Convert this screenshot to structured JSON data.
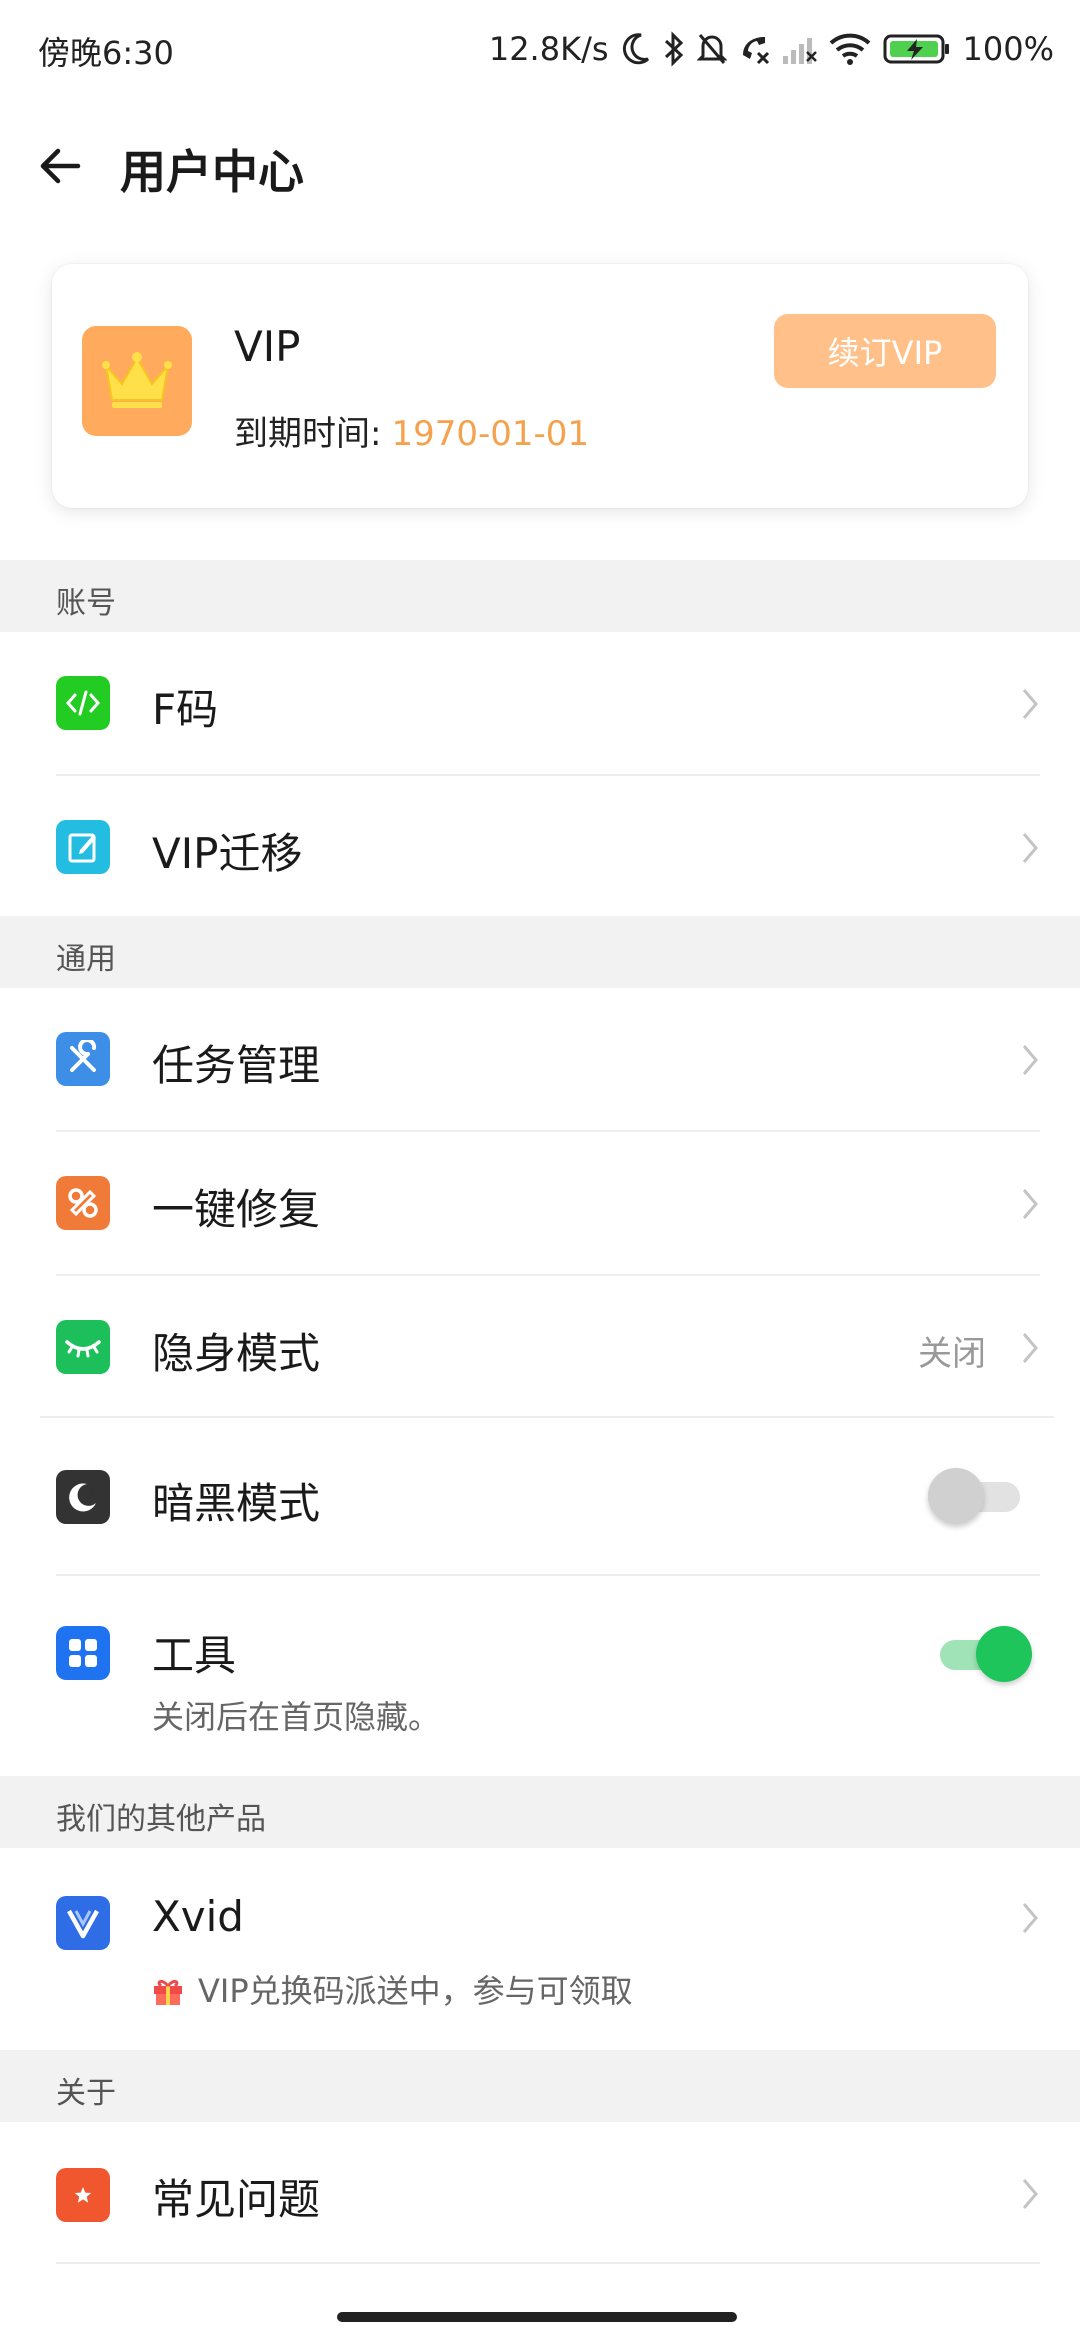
{
  "status_bar": {
    "time": "傍晚6:30",
    "speed": "12.8K/s",
    "battery": "100%",
    "icons": [
      "moon-icon",
      "bluetooth-icon",
      "mute-icon",
      "missed-call-icon",
      "signal-icon",
      "wifi-icon",
      "battery-charging-icon"
    ]
  },
  "header": {
    "title": "用户中心",
    "back_icon": "arrow-left-icon"
  },
  "vip_card": {
    "title": "VIP",
    "expire_label": "到期时间:",
    "expire_date": "1970-01-01",
    "renew_button": "续订VIP",
    "accent": "#ffaa5c",
    "date_color": "#f4a24e",
    "button_color": "#ffc189"
  },
  "sections": {
    "account": "账号",
    "general": "通用",
    "products": "我们的其他产品",
    "about": "关于"
  },
  "account_items": [
    {
      "label": "F码",
      "icon": "code-icon",
      "color": "#22cc22"
    },
    {
      "label": "VIP迁移",
      "icon": "edit-note-icon",
      "color": "#22bde0"
    }
  ],
  "general_items": {
    "tasks": {
      "label": "任务管理",
      "icon": "tools-icon",
      "color": "#3d8ee6"
    },
    "repair": {
      "label": "一键修复",
      "icon": "repair-icon",
      "color": "#f07a38"
    },
    "incognito": {
      "label": "隐身模式",
      "value": "关闭",
      "icon": "closed-eye-icon",
      "color": "#1dbf5b"
    },
    "dark": {
      "label": "暗黑模式",
      "icon": "moon-icon",
      "color": "#333333",
      "enabled": false
    },
    "tools": {
      "label": "工具",
      "sub": "关闭后在首页隐藏。",
      "icon": "grid-icon",
      "color": "#1f72f0",
      "enabled": true
    }
  },
  "products": {
    "xvid": {
      "label": "Xvid",
      "sub": "VIP兑换码派送中，参与可领取",
      "icon": "xvid-logo-icon",
      "color": "#2f6de6"
    }
  },
  "about_items": [
    {
      "label": "常见问题",
      "icon": "star-icon",
      "color": "#f0572e"
    }
  ]
}
